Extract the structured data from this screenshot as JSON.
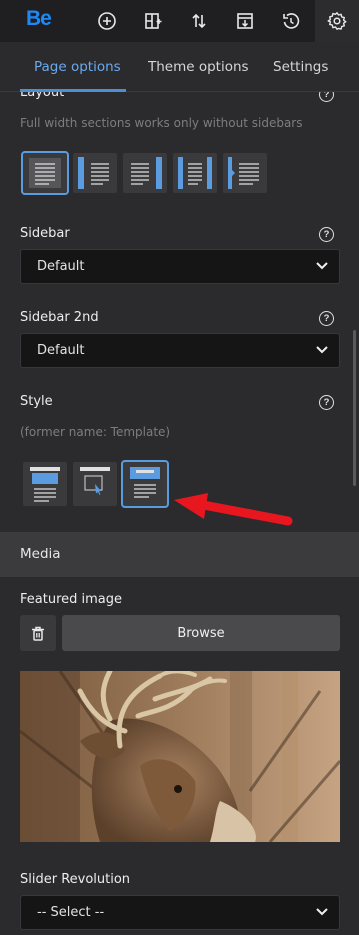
{
  "toolbar": {
    "logo": "Be",
    "tools": [
      {
        "name": "add-icon"
      },
      {
        "name": "layout-plus-icon"
      },
      {
        "name": "sort-icon"
      },
      {
        "name": "export-icon"
      },
      {
        "name": "revisions-icon"
      },
      {
        "name": "settings-gear-icon"
      }
    ]
  },
  "tabs": [
    {
      "label": "Page options",
      "active": true
    },
    {
      "label": "Theme options",
      "active": false
    },
    {
      "label": "Settings",
      "active": false
    }
  ],
  "layout": {
    "label": "Layout",
    "hint": "Full width sections works only without sidebars",
    "options": [
      "full-width",
      "left-sidebar",
      "right-sidebar",
      "both-sidebars",
      "offcanvas-sidebar"
    ],
    "selected_index": 0
  },
  "sidebar": {
    "label": "Sidebar",
    "value": "Default"
  },
  "sidebar2": {
    "label": "Sidebar 2nd",
    "value": "Default"
  },
  "style": {
    "label": "Style",
    "hint": "(former name: Template)",
    "options": [
      "default-style",
      "intro-style",
      "intro-header-style"
    ],
    "selected_index": 2
  },
  "media": {
    "section_title": "Media",
    "featured_image_label": "Featured image",
    "browse_label": "Browse"
  },
  "slider_revolution": {
    "label": "Slider Revolution",
    "value": "-- Select --"
  },
  "colors": {
    "accent": "#4a90d9",
    "annotation_arrow": "#e8161e"
  }
}
